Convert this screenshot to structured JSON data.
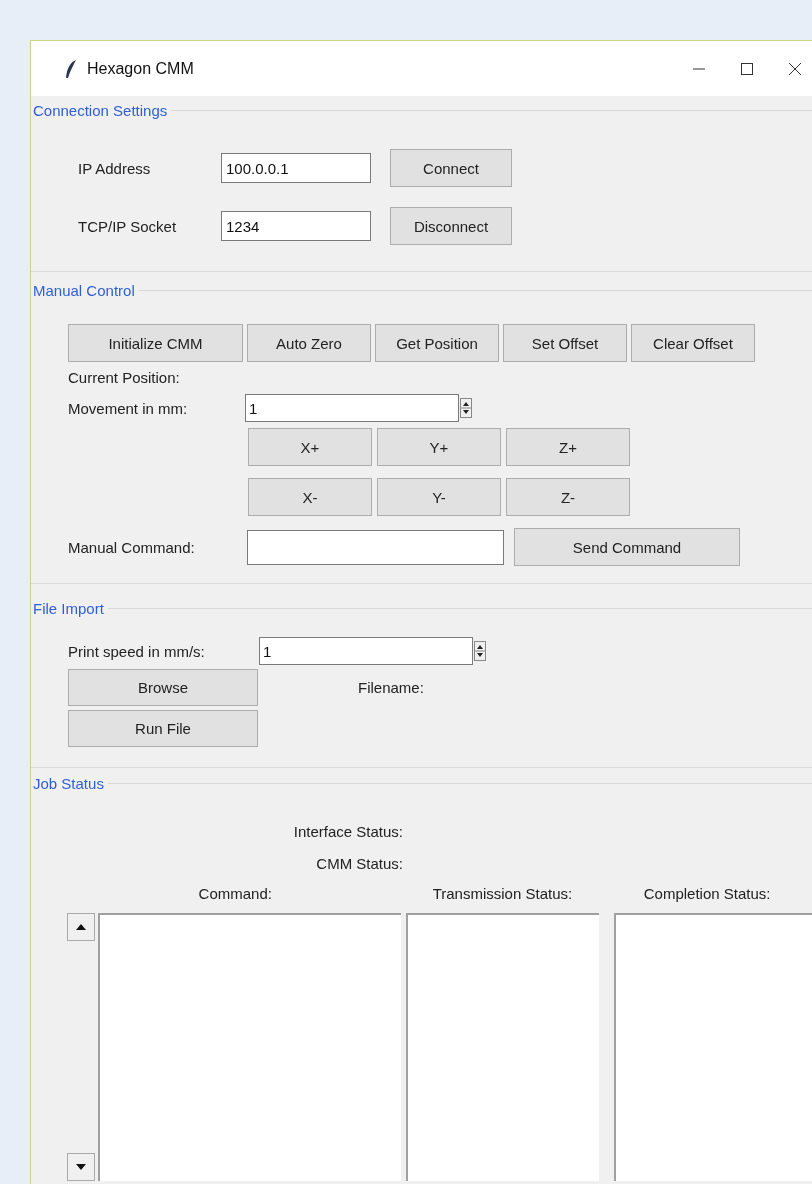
{
  "window": {
    "title": "Hexagon CMM"
  },
  "connection_settings": {
    "title": "Connection Settings",
    "fields": [
      {
        "label": "IP Address",
        "value": "100.0.0.1",
        "button": "Connect"
      },
      {
        "label": "TCP/IP Socket",
        "value": "1234",
        "button": "Disconnect"
      }
    ]
  },
  "manual_control": {
    "title": "Manual Control",
    "buttons": [
      "Initialize CMM",
      "Auto Zero",
      "Get Position",
      "Set Offset",
      "Clear Offset"
    ],
    "current_position_label": "Current Position:",
    "movement": {
      "label": "Movement in mm:",
      "value": "1"
    },
    "jog_buttons": [
      [
        "X+",
        "Y+",
        "Z+"
      ],
      [
        "X-",
        "Y-",
        "Z-"
      ]
    ],
    "manual_command": {
      "label": "Manual Command:",
      "button": "Send Command"
    }
  },
  "file_import": {
    "title": "File Import",
    "print_speed": {
      "label": "Print speed in mm/s:",
      "value": "1"
    },
    "browse_button": "Browse",
    "filename_label": "Filename:",
    "run_button": "Run File"
  },
  "job_status": {
    "title": "Job Status",
    "status_labels": [
      "Interface Status:",
      "CMM Status:"
    ],
    "columns": [
      "Command:",
      "Transmission Status:",
      "Completion Status:"
    ]
  }
}
